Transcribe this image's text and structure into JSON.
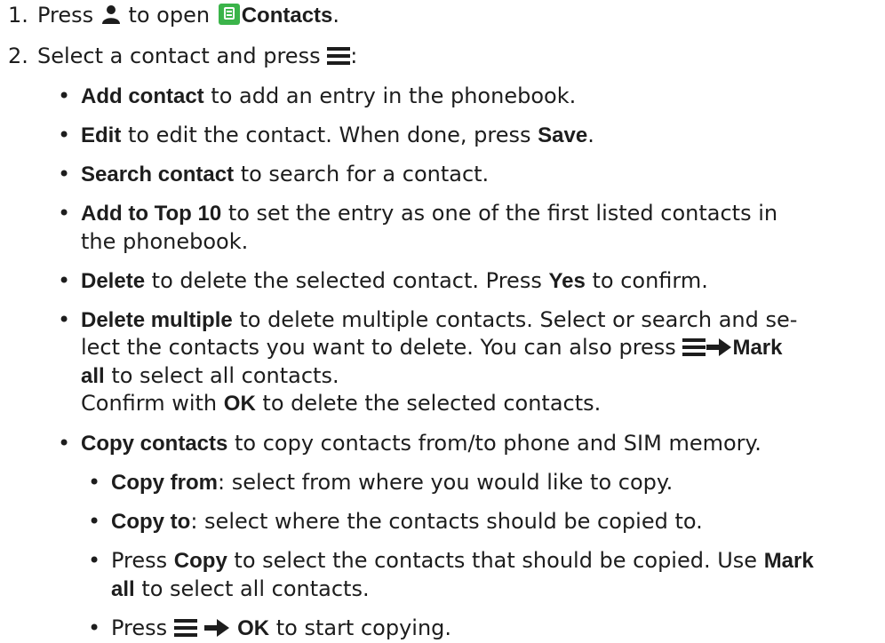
{
  "steps": [
    {
      "number": "1.",
      "text_a": "Press",
      "text_b": "to open",
      "app_name": "Contacts",
      "text_end": "."
    },
    {
      "number": "2.",
      "text_a": "Select a contact and press",
      "text_end": ":"
    }
  ],
  "options": [
    {
      "bold": "Add contact",
      "text": " to add an entry in the phonebook."
    },
    {
      "bold": "Edit",
      "text": " to edit the contact. When done, press ",
      "bold2": "Save",
      "text2": "."
    },
    {
      "bold": "Search contact",
      "text": " to search for a contact."
    },
    {
      "bold": "Add to Top 10",
      "text": " to set the entry as one of the first listed contacts in",
      "cont": "the phonebook."
    },
    {
      "bold": "Delete",
      "text": " to delete the selected contact. Press ",
      "bold2": "Yes",
      "text2": " to confirm."
    },
    {
      "bold": "Delete multiple",
      "text": " to delete multiple contacts. Select or search and se-",
      "cont1": "lect the contacts you want to delete. You can also press",
      "cont1_bold": "Mark",
      "cont2_bold": "all",
      "cont2": " to select all contacts.",
      "cont3": "Confirm with ",
      "cont3_bold": "OK",
      "cont3_end": " to delete the selected contacts."
    },
    {
      "bold": "Copy contacts",
      "text": " to copy contacts from/to phone and SIM memory."
    }
  ],
  "sub_options": [
    {
      "bold": "Copy from",
      "text": ": select from where you would like to copy."
    },
    {
      "bold": "Copy to",
      "text": ": select where the contacts should be copied to."
    },
    {
      "pre": "Press ",
      "bold": "Copy",
      "text": " to select the contacts that should be copied. Use ",
      "bold2": "Mark",
      "cont_bold": "all",
      "cont": " to select all contacts."
    },
    {
      "pre": "Press",
      "bold": "OK",
      "text": " to start copying."
    }
  ],
  "icons": {
    "person": "person-icon",
    "contacts_app": "contacts-app-icon",
    "menu": "menu-icon",
    "arrow": "arrow-right-icon"
  }
}
